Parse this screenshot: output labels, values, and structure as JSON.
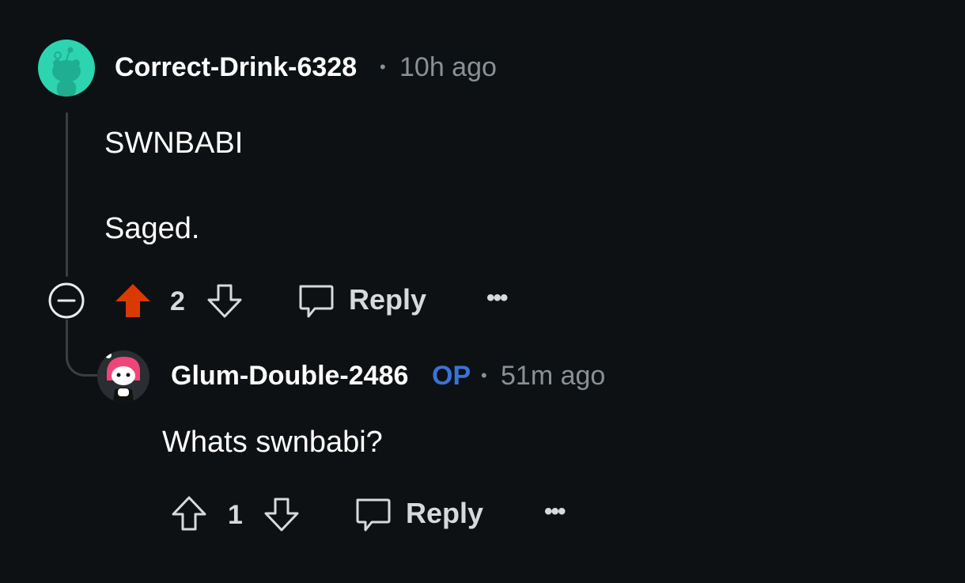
{
  "comments": [
    {
      "username": "Correct-Drink-6328",
      "separator": "•",
      "time": "10h ago",
      "body_line1": "SWNBABI",
      "body_line2": "Saged.",
      "vote_count": "2",
      "upvoted": true,
      "reply_label": "Reply",
      "more_label": "•••",
      "avatar_color": "#2dd4b0"
    },
    {
      "username": "Glum-Double-2486",
      "op_badge": "OP",
      "separator": "•",
      "time": "51m ago",
      "body_line1": "Whats swnbabi?",
      "vote_count": "1",
      "upvoted": false,
      "reply_label": "Reply",
      "more_label": "•••",
      "avatar_color": "#2a2d31"
    }
  ],
  "colors": {
    "background": "#0e1113",
    "upvote_active": "#d93a00",
    "op_badge": "#3b72d9",
    "meta_text": "#8a9195",
    "thread_line": "#3a3e41"
  },
  "icons": [
    "snoo-avatar-icon",
    "collapse-minus-icon",
    "upvote-arrow-icon",
    "downvote-arrow-icon",
    "comment-bubble-icon",
    "more-dots-icon"
  ]
}
